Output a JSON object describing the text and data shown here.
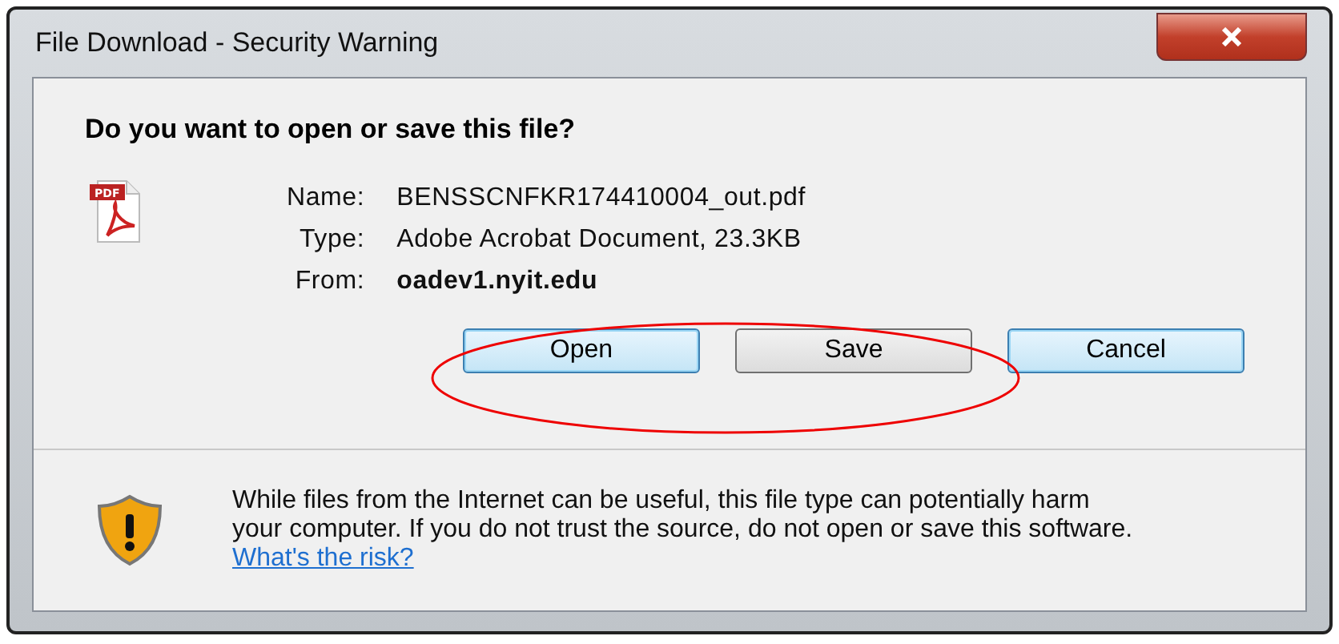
{
  "window": {
    "title": "File Download - Security Warning"
  },
  "pdf_icon_label": "PDF",
  "heading": "Do you want to open or save this file?",
  "fields": [
    {
      "label": "Name:",
      "value": "BENSSCNFKR174410004_out.pdf",
      "bold": false
    },
    {
      "label": "Type:",
      "value": "Adobe Acrobat Document, 23.3KB",
      "bold": false
    },
    {
      "label": "From:",
      "value": "oadev1.nyit.edu",
      "bold": true
    }
  ],
  "buttons": [
    {
      "label": "Open",
      "highlighted": true
    },
    {
      "label": "Save",
      "highlighted": false
    },
    {
      "label": "Cancel",
      "highlighted": true
    }
  ],
  "warning": {
    "text": "While files from the Internet can be useful, this file type can potentially harm your computer. If you do not trust the source, do not open or save this software.",
    "link": "What's the risk?"
  }
}
